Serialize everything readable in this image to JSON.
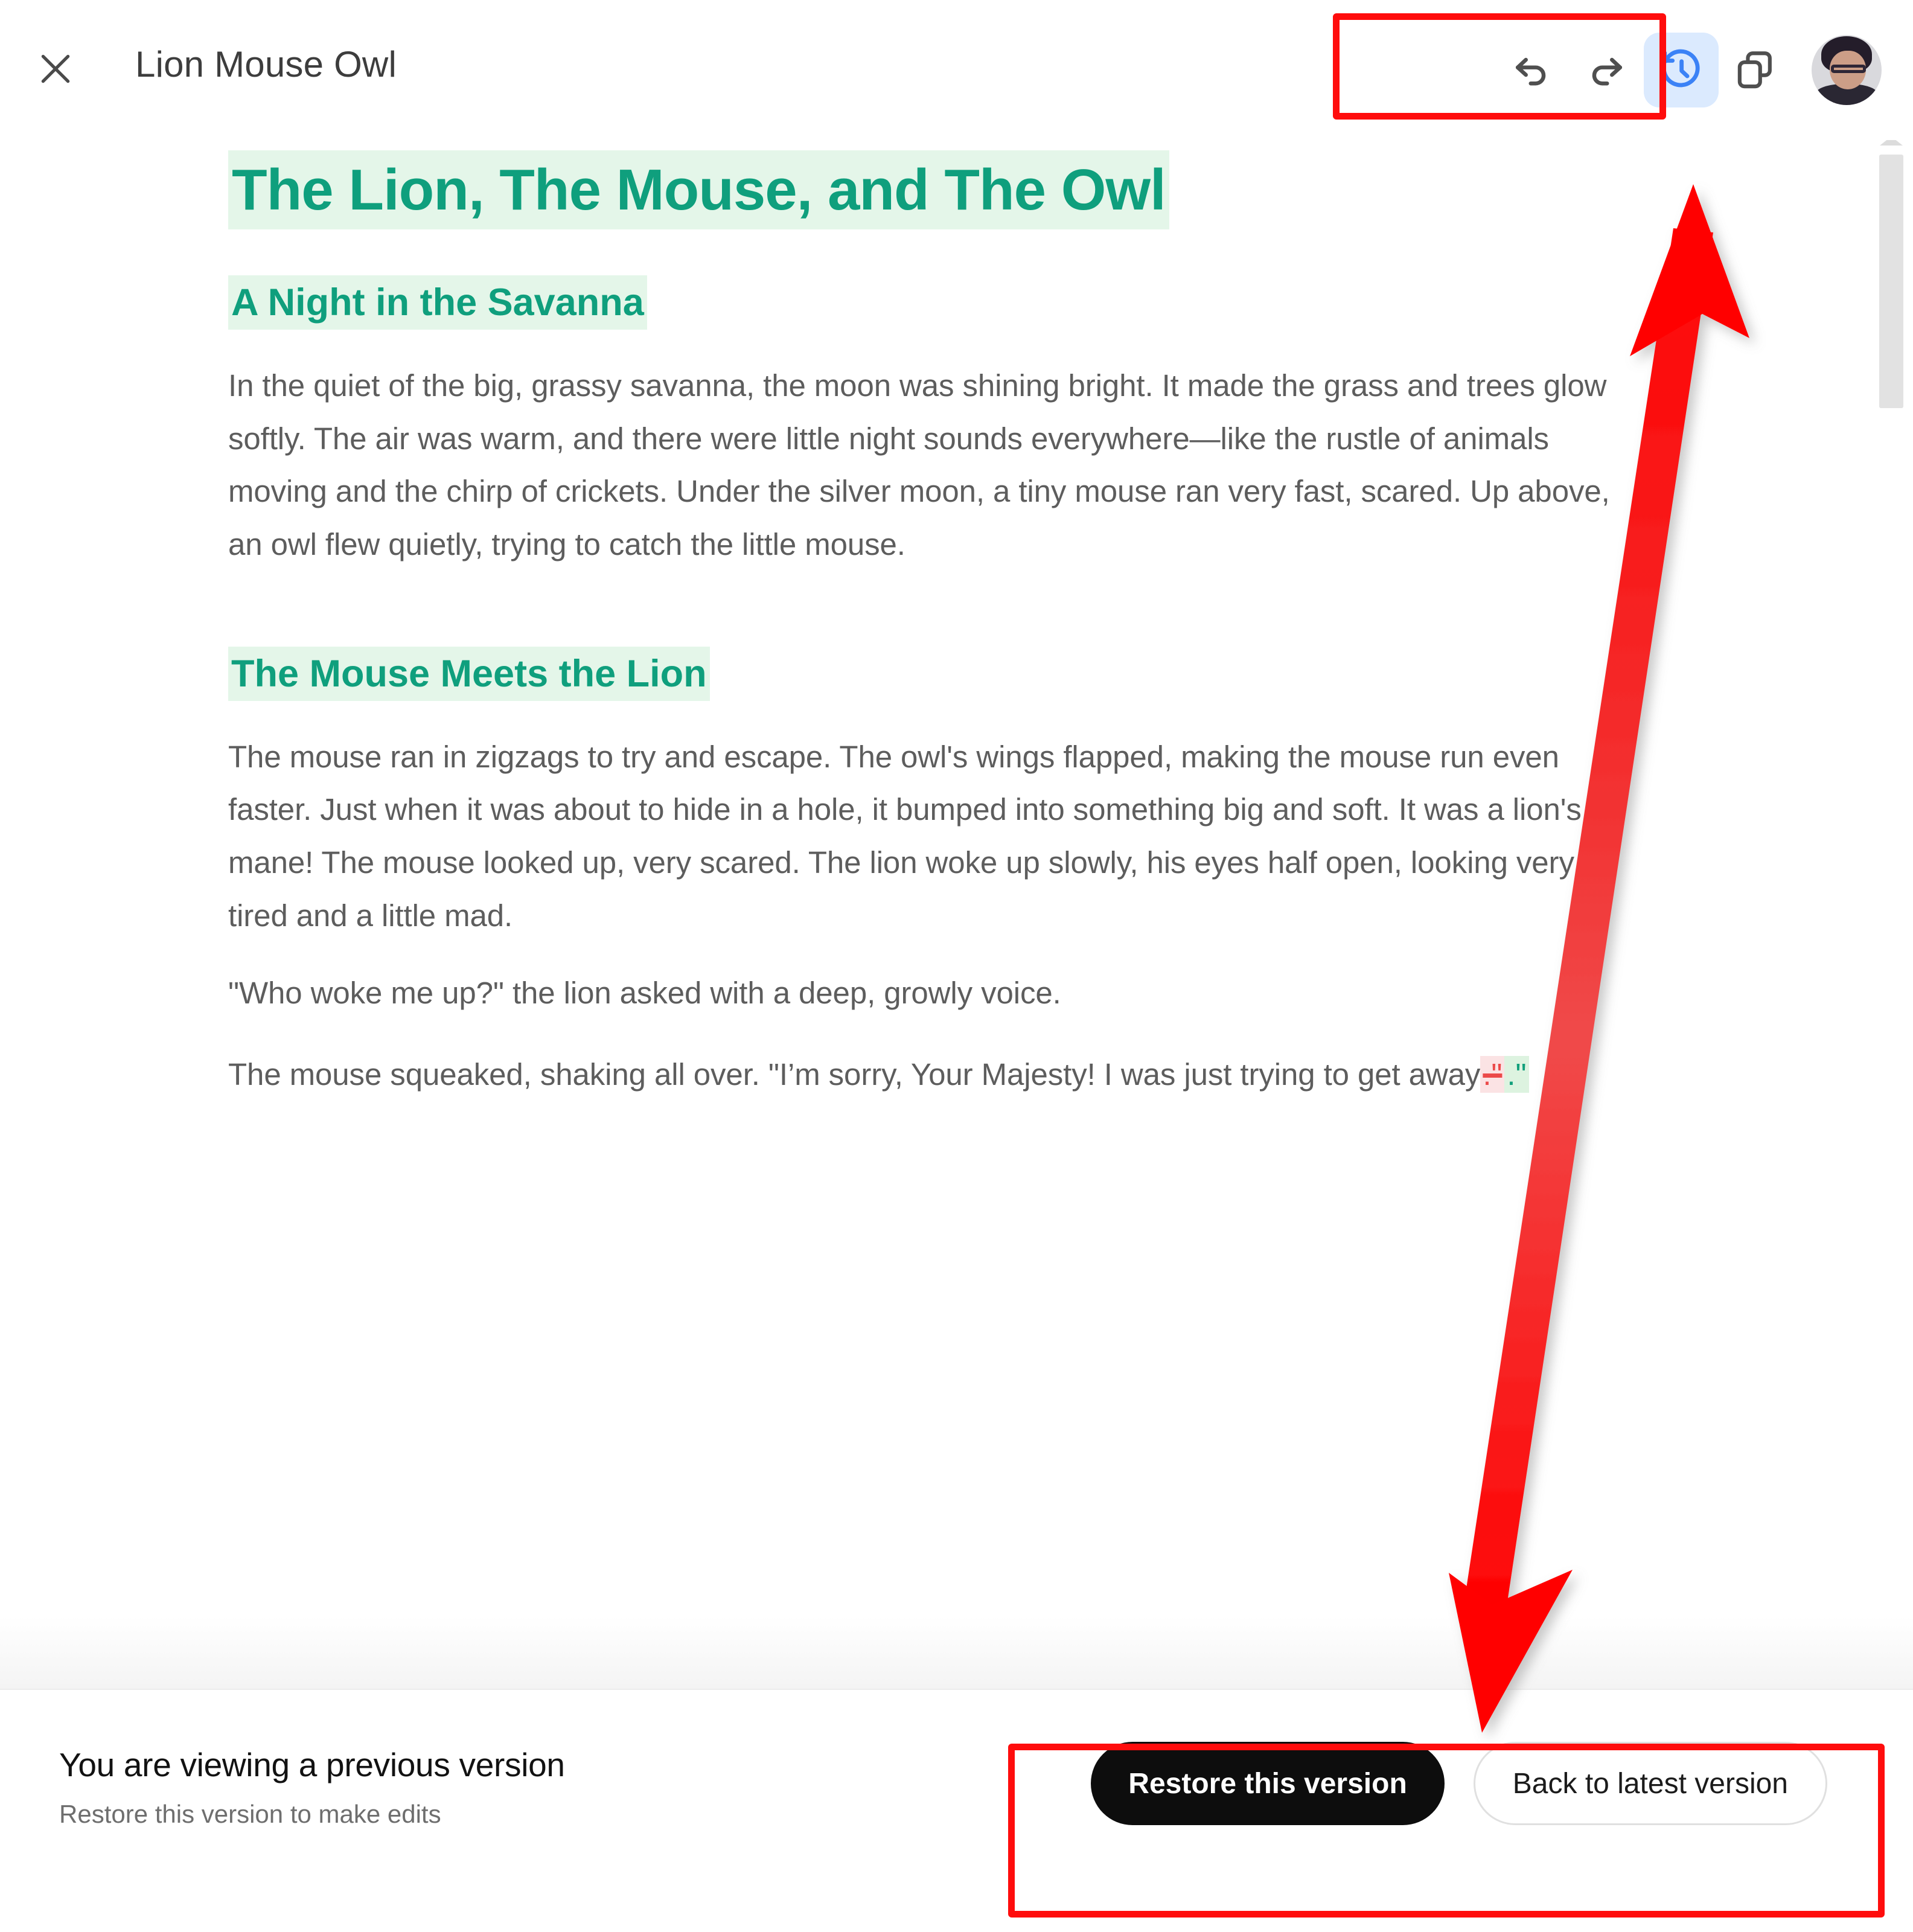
{
  "header": {
    "close_icon": "close-icon",
    "title": "Lion Mouse Owl",
    "toolbar": [
      {
        "id": "undo",
        "icon": "undo-icon",
        "label": "Undo",
        "active": false
      },
      {
        "id": "redo",
        "icon": "redo-icon",
        "label": "Redo",
        "active": false
      },
      {
        "id": "history",
        "icon": "history-clock-icon",
        "label": "Version history",
        "active": true
      },
      {
        "id": "copy",
        "icon": "copy-icon",
        "label": "Copy",
        "active": false
      }
    ],
    "avatar_label": "User avatar"
  },
  "document": {
    "h1": "The Lion, The Mouse, and The Owl",
    "sections": [
      {
        "heading": "A Night in the Savanna",
        "paragraphs": [
          "In the quiet of the big, grassy savanna, the moon was shining bright. It made the grass and trees glow softly. The air was warm, and there were little night sounds everywhere—like the rustle of animals moving and the chirp of crickets. Under the silver moon, a tiny mouse ran very fast, scared. Up above, an owl flew quietly, trying to catch the little mouse."
        ]
      },
      {
        "heading": "The Mouse Meets the Lion",
        "paragraphs": [
          "The mouse ran in zigzags to try and escape. The owl's wings flapped, making the mouse run even faster. Just when it was about to hide in a hole, it bumped into something big and soft. It was a lion's mane! The mouse looked up, very scared. The lion woke up slowly, his eyes half open, looking very tired and a little mad.",
          "\"Who woke me up?\" the lion asked with a deep, growly voice."
        ]
      }
    ],
    "last_paragraph": {
      "before": "The mouse squeaked, shaking all over. \"I’m sorry, Your Majesty! I was just trying to get away",
      "deleted": ".\"",
      "inserted": ".\""
    }
  },
  "scrollbar": {
    "caret_icon": "scroll-up-caret-icon",
    "thumb_label": "vertical-scroll-thumb"
  },
  "bottom_bar": {
    "title": "You are viewing a previous version",
    "subtitle": "Restore this version to make edits",
    "primary_button": "Restore this version",
    "secondary_button": "Back to latest version"
  },
  "annotations": {
    "box_toolbar_label": "highlight-box-toolbar",
    "box_buttons_label": "highlight-box-version-actions",
    "arrow_label": "double-headed-annotation-arrow",
    "color": "#ff0d0d"
  },
  "colors": {
    "heading_green": "#0f9f7d",
    "heading_highlight": "#e4f6e9",
    "body_gray": "#5d5d5d",
    "accent_blue": "#3b82f6",
    "active_pill": "#dbeafe",
    "diff_delete_bg": "#fbe3e4",
    "diff_delete_fg": "#ec4a4a",
    "diff_insert_bg": "#ddf3e0",
    "diff_insert_fg": "#12a07c",
    "annotation_red": "#ff0d0d"
  }
}
